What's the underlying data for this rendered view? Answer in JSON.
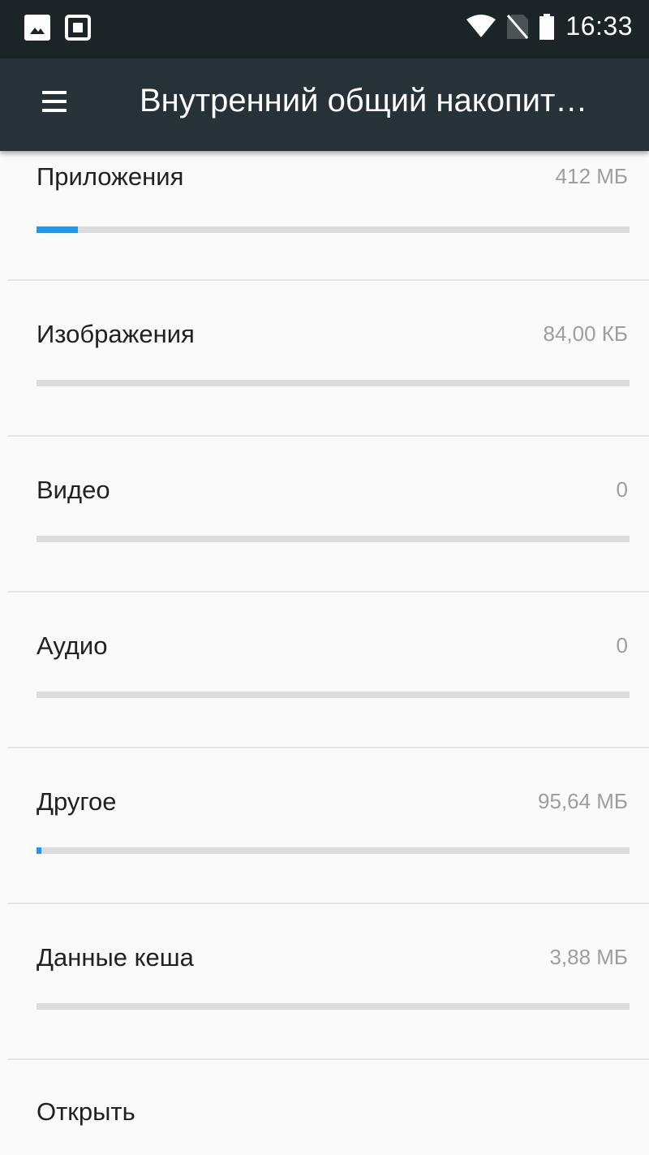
{
  "status_bar": {
    "time": "16:33",
    "icons": [
      "image-notification-icon",
      "screenshot-notification-icon",
      "wifi-icon",
      "no-sim-icon",
      "battery-icon"
    ]
  },
  "app_bar": {
    "menu_icon": "hamburger-menu-icon",
    "title": "Внутренний общий накопит…"
  },
  "storage_items": [
    {
      "label": "Приложения",
      "value": "412 МБ",
      "fill_fraction": 0.07
    },
    {
      "label": "Изображения",
      "value": "84,00 КБ",
      "fill_fraction": 0.0
    },
    {
      "label": "Видео",
      "value": "0",
      "fill_fraction": 0.0
    },
    {
      "label": "Аудио",
      "value": "0",
      "fill_fraction": 0.0
    },
    {
      "label": "Другое",
      "value": "95,64 МБ",
      "fill_fraction": 0.008
    },
    {
      "label": "Данные кеша",
      "value": "3,88 МБ",
      "fill_fraction": 0.0
    }
  ],
  "open_item": {
    "label": "Открыть"
  },
  "colors": {
    "status_bar": "#1b2427",
    "app_bar": "#263238",
    "accent": "#2196f3",
    "track": "#dcdcdc",
    "background": "#fafafa"
  }
}
